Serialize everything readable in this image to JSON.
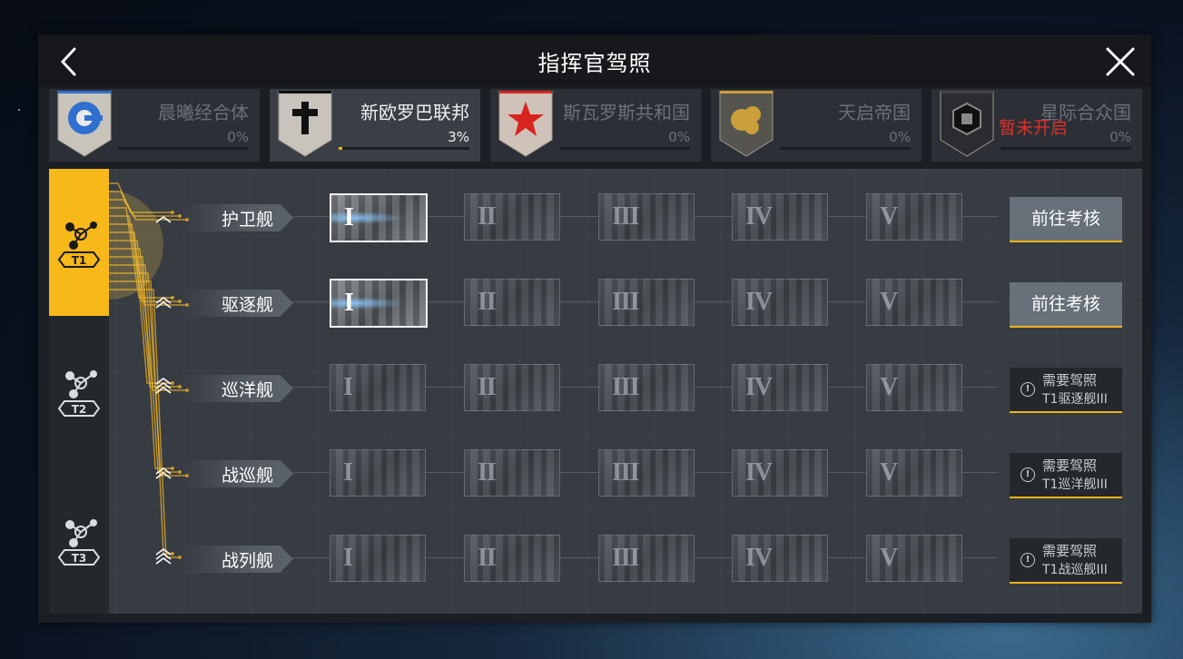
{
  "title": "指挥官驾照",
  "factions": [
    {
      "name": "晨曦经合体",
      "percent": "0%",
      "progress": 0,
      "emblem": "shield-blue-ring-emblem",
      "color": "#2f6fd0",
      "selected": false,
      "locked_text": ""
    },
    {
      "name": "新欧罗巴联邦",
      "percent": "3%",
      "progress": 0.03,
      "emblem": "shield-black-cross-emblem",
      "color": "#111111",
      "selected": true,
      "locked_text": ""
    },
    {
      "name": "斯瓦罗斯共和国",
      "percent": "0%",
      "progress": 0,
      "emblem": "shield-red-star-emblem",
      "color": "#d8241f",
      "selected": false,
      "locked_text": ""
    },
    {
      "name": "天启帝国",
      "percent": "0%",
      "progress": 0,
      "emblem": "shield-gold-orb-emblem",
      "color": "#c9a03a",
      "selected": false,
      "locked_text": ""
    },
    {
      "name": "星际合众国",
      "percent": "0%",
      "progress": 0,
      "emblem": "shield-dark-cube-emblem",
      "color": "#444444",
      "selected": false,
      "locked_text": "暂未开启"
    }
  ],
  "tiers": [
    {
      "label": "T1",
      "active": true
    },
    {
      "label": "T2",
      "active": false
    },
    {
      "label": "T3",
      "active": false
    }
  ],
  "numerals": [
    "I",
    "II",
    "III",
    "IV",
    "V"
  ],
  "rows": [
    {
      "ship": "护卫舰",
      "chevrons": 1,
      "active_levels": 1,
      "action": {
        "type": "button",
        "label": "前往考核"
      }
    },
    {
      "ship": "驱逐舰",
      "chevrons": 2,
      "active_levels": 1,
      "action": {
        "type": "button",
        "label": "前往考核"
      }
    },
    {
      "ship": "巡洋舰",
      "chevrons": 3,
      "active_levels": 0,
      "action": {
        "type": "requirement",
        "line1": "需要驾照",
        "line2": "T1驱逐舰III"
      }
    },
    {
      "ship": "战巡舰",
      "chevrons": 2,
      "active_levels": 0,
      "action": {
        "type": "requirement",
        "line1": "需要驾照",
        "line2": "T1巡洋舰III"
      }
    },
    {
      "ship": "战列舰",
      "chevrons": 3,
      "active_levels": 0,
      "action": {
        "type": "requirement",
        "line1": "需要驾照",
        "line2": "T1战巡舰III"
      }
    }
  ],
  "accent_color": "#f7b819"
}
